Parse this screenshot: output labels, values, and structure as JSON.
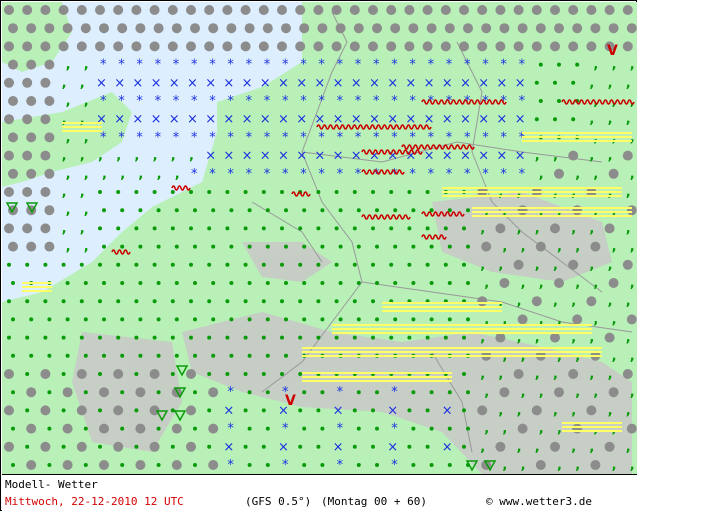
{
  "footer": {
    "title": "Modell- Wetter",
    "date_time": "Mittwoch, 22-12-2010  12 UTC",
    "model": "(GFS 0.5°)",
    "run": "(Montag 00 + 60)",
    "site": "© www.wetter3.de"
  },
  "legend_symbols": {
    "snow": "snow-asterisk",
    "light_snow": "snow-cross",
    "rain": "rain-dot",
    "drizzle": "drizzle-comma",
    "fog": "fog-lines",
    "freezing_rain": "freezing-rain-wave",
    "showers": "shower-triangle",
    "thunder": "thunder-v",
    "cloud_cover": "cloud-cover-circle"
  },
  "colors": {
    "land": "#b8f0b8",
    "sea": "#ddeeff",
    "mountains": "#bbbbbb",
    "snow": "#1a2fe0",
    "rain": "#0a9a0a",
    "fog": "#ffff66",
    "freezing": "#cc0000",
    "cloud": "#8c8c8c",
    "footer_date": "#d40000"
  }
}
